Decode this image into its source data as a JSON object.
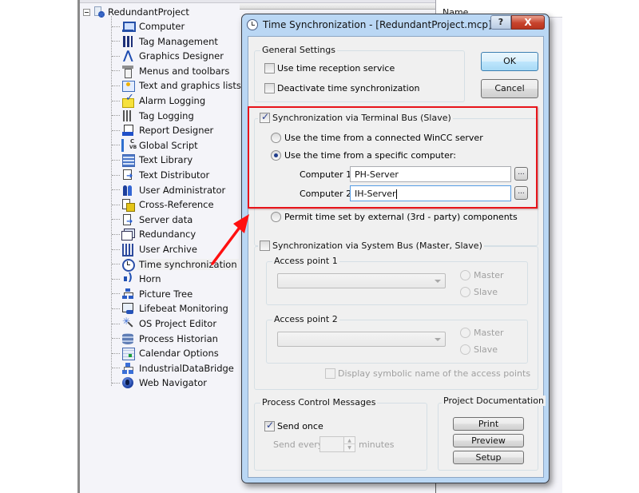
{
  "background": {
    "right_pane_header": "Name",
    "tree": {
      "root": "RedundantProject",
      "items": [
        {
          "label": "Computer",
          "icon": "computer-icon"
        },
        {
          "label": "Tag Management",
          "icon": "tag-management-icon"
        },
        {
          "label": "Graphics Designer",
          "icon": "graphics-designer-icon"
        },
        {
          "label": "Menus and toolbars",
          "icon": "menus-toolbars-icon"
        },
        {
          "label": "Text and graphics lists",
          "icon": "text-graphics-lists-icon"
        },
        {
          "label": "Alarm Logging",
          "icon": "alarm-logging-icon"
        },
        {
          "label": "Tag Logging",
          "icon": "tag-logging-icon"
        },
        {
          "label": "Report Designer",
          "icon": "report-designer-icon"
        },
        {
          "label": "Global Script",
          "icon": "global-script-icon"
        },
        {
          "label": "Text Library",
          "icon": "text-library-icon"
        },
        {
          "label": "Text Distributor",
          "icon": "text-distributor-icon"
        },
        {
          "label": "User Administrator",
          "icon": "user-administrator-icon"
        },
        {
          "label": "Cross-Reference",
          "icon": "cross-reference-icon"
        },
        {
          "label": "Server data",
          "icon": "server-data-icon"
        },
        {
          "label": "Redundancy",
          "icon": "redundancy-icon"
        },
        {
          "label": "User Archive",
          "icon": "user-archive-icon"
        },
        {
          "label": "Time synchronization",
          "icon": "clock-icon",
          "selected": true
        },
        {
          "label": "Horn",
          "icon": "horn-icon"
        },
        {
          "label": "Picture Tree",
          "icon": "picture-tree-icon"
        },
        {
          "label": "Lifebeat Monitoring",
          "icon": "lifebeat-monitoring-icon"
        },
        {
          "label": "OS Project Editor",
          "icon": "os-project-editor-icon"
        },
        {
          "label": "Process Historian",
          "icon": "process-historian-icon"
        },
        {
          "label": "Calendar Options",
          "icon": "calendar-options-icon"
        },
        {
          "label": "IndustrialDataBridge",
          "icon": "industrial-data-bridge-icon"
        },
        {
          "label": "Web Navigator",
          "icon": "web-navigator-icon"
        }
      ]
    }
  },
  "annotation": {
    "highlight_color": "#e8141a",
    "arrow_color": "#ff1010"
  },
  "dialog": {
    "title": "Time Synchronization - [RedundantProject.mcp]",
    "help_label": "?",
    "close_label": "X",
    "ok_label": "OK",
    "cancel_label": "Cancel",
    "general_settings": {
      "title": "General Settings",
      "use_time_reception": {
        "label": "Use time reception service",
        "checked": false
      },
      "deactivate_sync": {
        "label": "Deactivate time synchronization",
        "checked": false
      }
    },
    "terminal_bus": {
      "label": "Synchronization via Terminal Bus (Slave)",
      "checked": true,
      "option_connected_server": {
        "label": "Use the time from a connected WinCC server",
        "selected": false
      },
      "option_specific_computer": {
        "label": "Use the time from a specific computer:",
        "selected": true
      },
      "computer1": {
        "label": "Computer 1:",
        "value": "PH-Server"
      },
      "computer2": {
        "label": "Computer 2:",
        "value": "IH-Server"
      },
      "browse_label": "...",
      "option_external": {
        "label": "Permit time set by external (3rd - party) components",
        "selected": false
      }
    },
    "system_bus": {
      "label": "Synchronization via System Bus (Master, Slave)",
      "checked": false,
      "access_point_1": {
        "title": "Access point 1",
        "value": "",
        "master_label": "Master",
        "slave_label": "Slave"
      },
      "access_point_2": {
        "title": "Access point 2",
        "value": "",
        "master_label": "Master",
        "slave_label": "Slave"
      },
      "display_symbolic": {
        "label": "Display symbolic name of the access points",
        "checked": false
      }
    },
    "process_control": {
      "title": "Process Control Messages",
      "send_once": {
        "label": "Send once",
        "checked": true
      },
      "send_every_label": "Send every",
      "send_every_value": "",
      "minutes_label": "minutes"
    },
    "project_documentation": {
      "title": "Project Documentation",
      "print_label": "Print",
      "preview_label": "Preview",
      "setup_label": "Setup"
    }
  }
}
